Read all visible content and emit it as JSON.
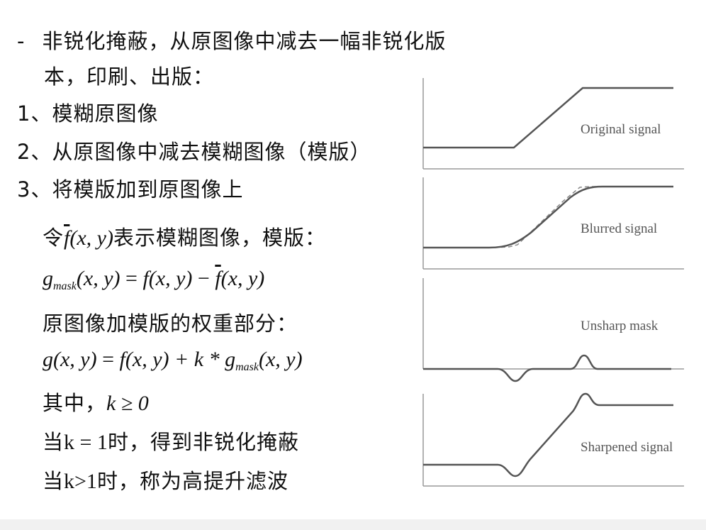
{
  "text": {
    "bullet_dash": "-",
    "intro_line1": "非锐化掩蔽，从原图像中减去一幅非锐化版",
    "intro_line2": "本，印刷、出版：",
    "step1": "1、模糊原图像",
    "step2": "2、从原图像中减去模糊图像（模版）",
    "step3": "3、将模版加到原图像上",
    "let_prefix": "令",
    "f": "f",
    "args": "(x, y)",
    "let_suffix": "表示模糊图像，模版：",
    "g": "g",
    "mask_sub": "mask",
    "eq": " = ",
    "minus": " − ",
    "weighted_text": "原图像加模版的权重部分：",
    "g_args": "g(x, y)",
    "plus_k": " + k * ",
    "where_prefix": "其中，",
    "k_cond": "k ≥ 0",
    "k1_prefix": "当",
    "k1_expr": "k = 1",
    "k1_suffix": "时，得到非锐化掩蔽",
    "kgt_prefix": "当",
    "kgt_expr": "k>1",
    "kgt_suffix": "时，称为高提升滤波"
  },
  "diagram": {
    "labels": {
      "original": "Original signal",
      "blurred": "Blurred signal",
      "mask": "Unsharp mask",
      "sharpened": "Sharpened signal"
    },
    "line_color": "#555555",
    "dash_color": "#888888",
    "axis_color": "#999999"
  }
}
